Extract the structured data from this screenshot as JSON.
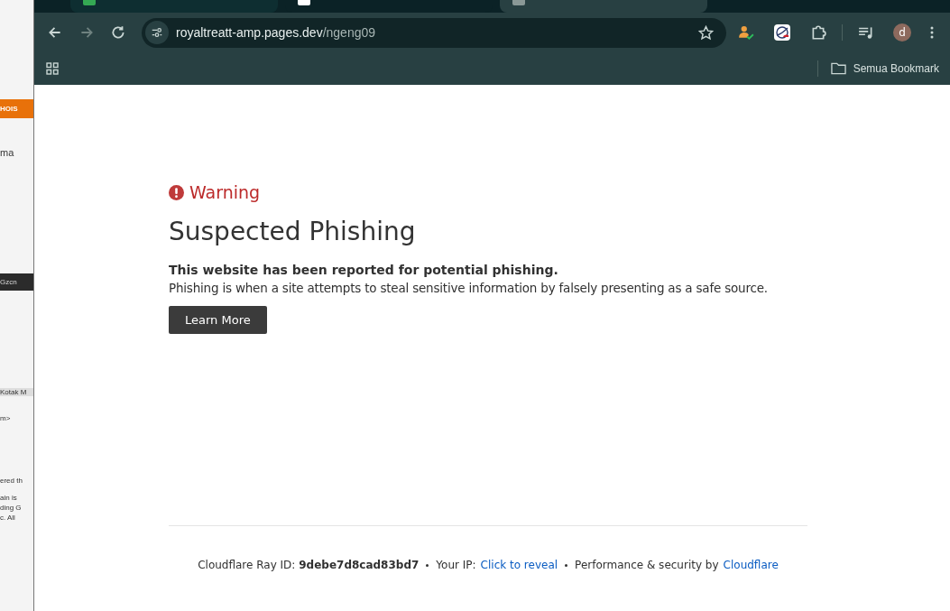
{
  "background_window": {
    "fragments": [
      "HOIS",
      "ma",
      "Gzcn",
      "Kotak M",
      "m>",
      "ered th",
      "ain is",
      "ding G",
      "c. All"
    ]
  },
  "tabs": [
    {
      "selected": false
    },
    {
      "selected": false
    },
    {
      "selected": true
    }
  ],
  "address_bar": {
    "host": "royaltreatt-amp.pages.dev",
    "path": "/ngeng09"
  },
  "profile": {
    "initial": "d"
  },
  "bookmarks_bar": {
    "all_bookmarks": "Semua Bookmark"
  },
  "page": {
    "warning": "Warning",
    "title": "Suspected Phishing",
    "lead": "This website has been reported for potential phishing.",
    "body": "Phishing is when a site attempts to steal sensitive information by falsely presenting as a safe source.",
    "button": "Learn More"
  },
  "footer": {
    "ray_label": "Cloudflare Ray ID:",
    "ray_id": "9debe7d8cad83bd7",
    "ip_label": "Your IP:",
    "ip_link": "Click to reveal",
    "perf_label": "Performance & security by",
    "perf_link": "Cloudflare"
  }
}
